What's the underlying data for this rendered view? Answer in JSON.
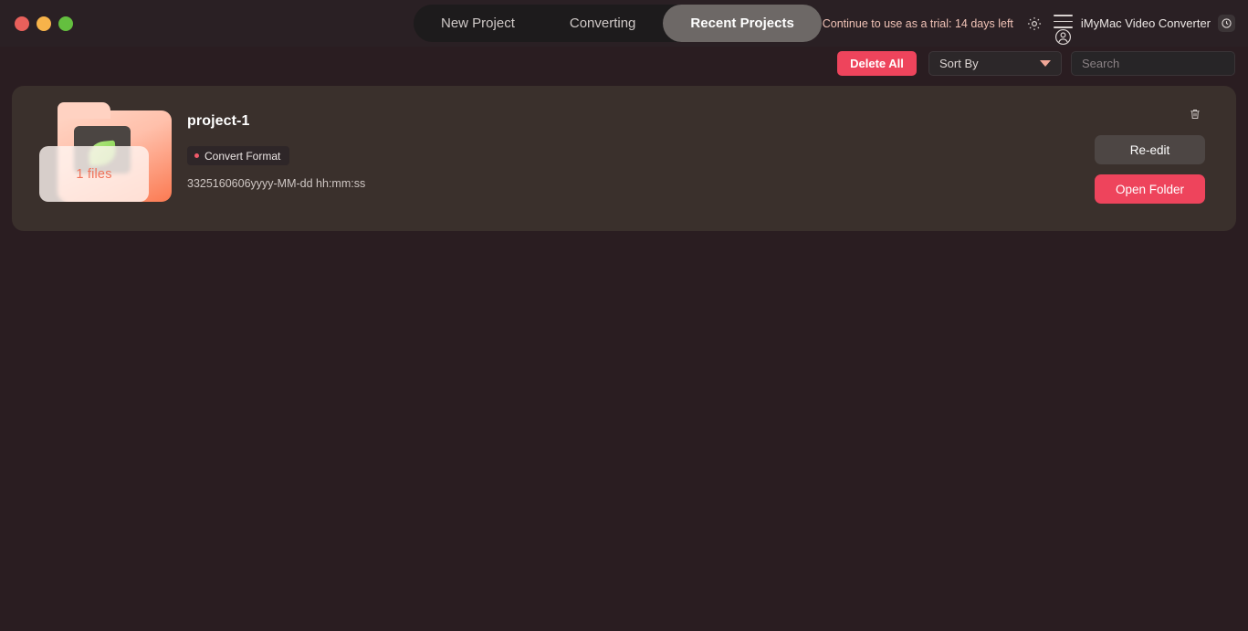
{
  "window": {
    "traffic_lights": [
      {
        "name": "close",
        "color": "#e8605b"
      },
      {
        "name": "minimize",
        "color": "#f7b34a"
      },
      {
        "name": "maximize",
        "color": "#64bf3f"
      }
    ]
  },
  "tabs": [
    {
      "label": "New Project",
      "active": false
    },
    {
      "label": "Converting",
      "active": false
    },
    {
      "label": "Recent Projects",
      "active": true
    }
  ],
  "header": {
    "trial_text": "Continue to use as a trial: 14 days left",
    "gear_icon": "gear-icon",
    "menu_icon": "hamburger-menu-icon",
    "account_icon": "account-circle-icon",
    "app_name": "iMyMac Video Converter",
    "power_icon": "power-icon"
  },
  "toolbar": {
    "delete_all_label": "Delete All",
    "sort_by_label": "Sort By",
    "sort_caret_icon": "chevron-down-icon",
    "search_placeholder": "Search",
    "search_value": ""
  },
  "projects": [
    {
      "title": "project-1",
      "badge_label": "Convert Format",
      "timestamp": "3325160606yyyy-MM-dd hh:mm:ss",
      "file_count_label": "1 files",
      "delete_icon": "trash-icon",
      "reedit_label": "Re-edit",
      "open_folder_label": "Open Folder"
    }
  ],
  "colors": {
    "page_background": "#2a1d21",
    "titlebar_background": "#2a2024",
    "card_background": "#3a302c",
    "accent_red": "#ee445c",
    "accent_salmon": "#f0a697",
    "tab_active_background": "#6d6866",
    "folder_orange": "#fb7a52"
  }
}
